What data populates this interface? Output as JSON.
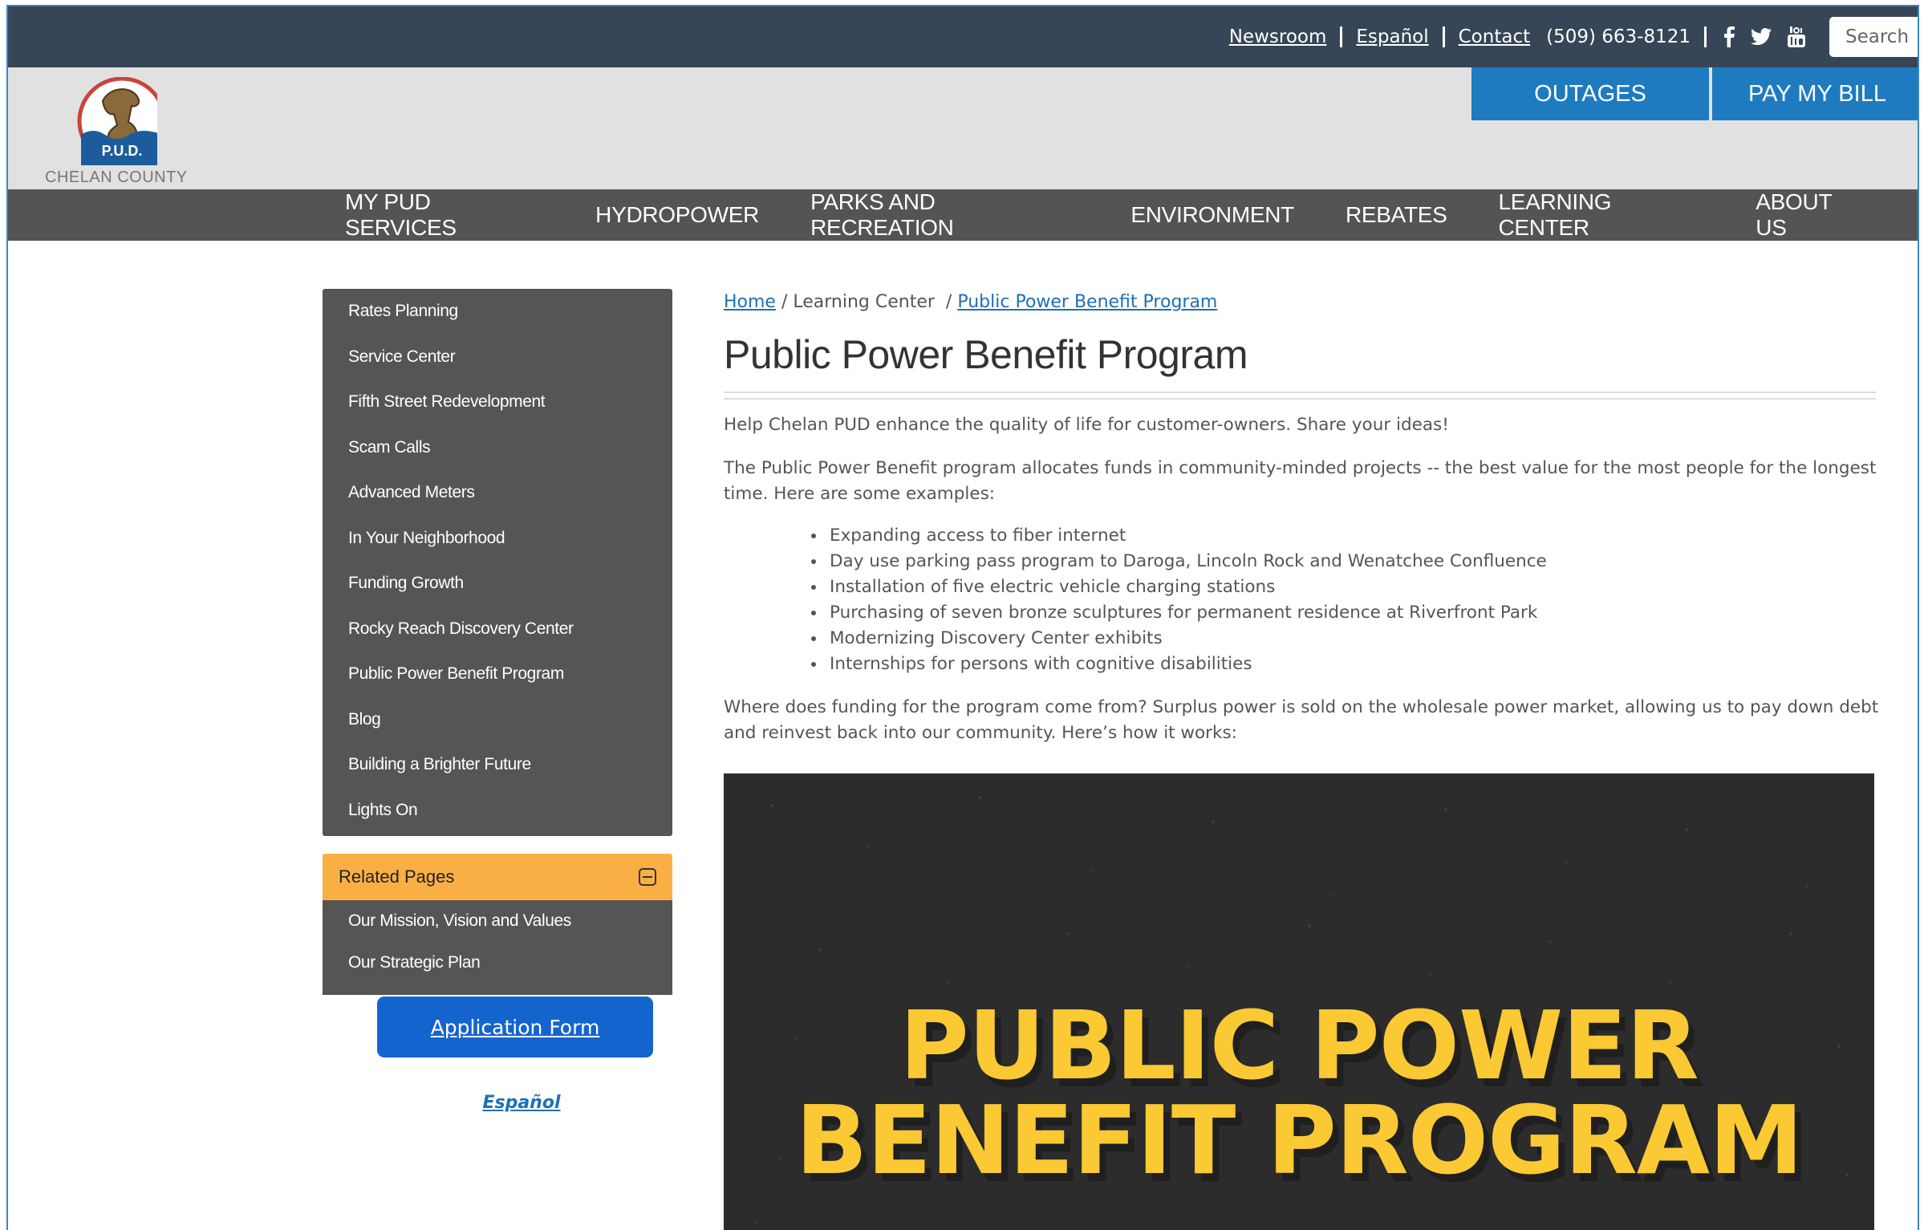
{
  "utility": {
    "links": [
      "Newsroom",
      "Español",
      "Contact"
    ],
    "phone": "(509) 663-8121",
    "search_placeholder": "Search",
    "social_icons": [
      "facebook-icon",
      "twitter-icon",
      "youtube-icon"
    ]
  },
  "header": {
    "logo_badge": "P.U.D.",
    "logo_text": "CHELAN COUNTY",
    "outages_label": "OUTAGES",
    "pay_label": "PAY MY BILL"
  },
  "nav": {
    "items": [
      "MY PUD SERVICES",
      "HYDROPOWER",
      "PARKS AND RECREATION",
      "ENVIRONMENT",
      "REBATES",
      "LEARNING CENTER",
      "ABOUT US"
    ]
  },
  "sidebar": {
    "items": [
      "Rates Planning",
      "Service Center",
      "Fifth Street Redevelopment",
      "Scam Calls",
      "Advanced Meters",
      "In Your Neighborhood",
      "Funding Growth",
      "Rocky Reach Discovery Center",
      "Public Power Benefit Program",
      "Blog",
      "Building a Brighter Future",
      "Lights On"
    ],
    "related_title": "Related Pages",
    "related_items": [
      "Our Mission, Vision and Values",
      "Our Strategic Plan"
    ],
    "application_button": "Application Form",
    "espanol_link": "Español"
  },
  "content": {
    "breadcrumb": {
      "home": "Home",
      "sep1": " / ",
      "section": "Learning Center",
      "sep2": "  / ",
      "current": "Public Power Benefit Program"
    },
    "title": "Public Power Benefit Program",
    "intro": "Help Chelan PUD enhance the quality of life for customer-owners. Share your ideas!",
    "description": "The Public Power Benefit program allocates funds in community-minded projects -- the best value for the most people for the longest time. Here are some examples:",
    "examples": [
      "Expanding access to fiber internet",
      "Day use parking pass program to Daroga, Lincoln Rock and Wenatchee Confluence",
      "Installation of five electric vehicle charging stations",
      "Purchasing of seven bronze sculptures for permanent residence at Riverfront Park",
      "Modernizing Discovery Center exhibits",
      "Internships for persons with cognitive disabilities"
    ],
    "funding": "Where does funding for the program come from? Surplus power is sold on the wholesale power market, allowing us to pay down debt and reinvest back into our community. Here’s how it works:",
    "hero_line1": "PUBLIC POWER",
    "hero_line2": "BENEFIT PROGRAM"
  },
  "colors": {
    "utility_bar": "#364656",
    "header_band": "#e1e1e1",
    "cta_blue": "#1f7bbf",
    "nav_gray": "#545454",
    "related_orange": "#f9af43",
    "app_button": "#1464d0",
    "hero_yellow": "#fbc934"
  }
}
